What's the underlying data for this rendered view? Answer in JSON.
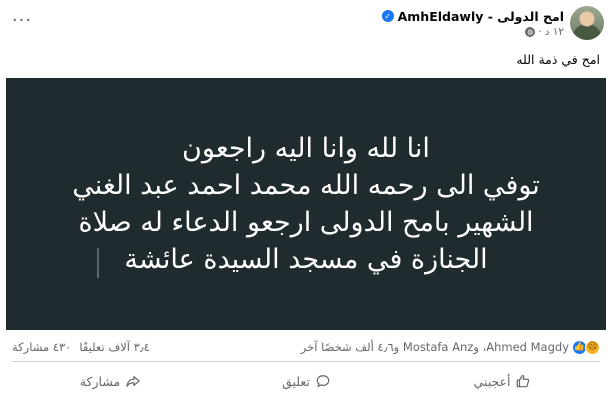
{
  "post": {
    "author": "AmhEldawly - امح الدولى",
    "time": "١٢ د",
    "caption": "امح في ذمة الله",
    "more_label": "···"
  },
  "image_text": {
    "lines": [
      "انا لله وانا اليه راجعون",
      "توفي الى رحمه الله محمد احمد عبد الغني",
      "الشهير بامح الدولى ارجعو الدعاء له صلاة",
      "الجنازة في مسجد السيدة عائشة"
    ],
    "background": "#202b30"
  },
  "reactions": {
    "summary": "Ahmed Magdy، وMostafa Anz و٤٫٦ ألف شخصًا آخر",
    "comments": "٣٫٤ آلاف تعليقًا",
    "shares": "٤٣٠ مشاركة",
    "icons": [
      "like-icon",
      "sad-icon"
    ]
  },
  "actions": {
    "like": "أعجبني",
    "comment": "تعليق",
    "share": "مشاركة"
  },
  "colors": {
    "accent": "#1877f2",
    "muted": "#65676b"
  }
}
